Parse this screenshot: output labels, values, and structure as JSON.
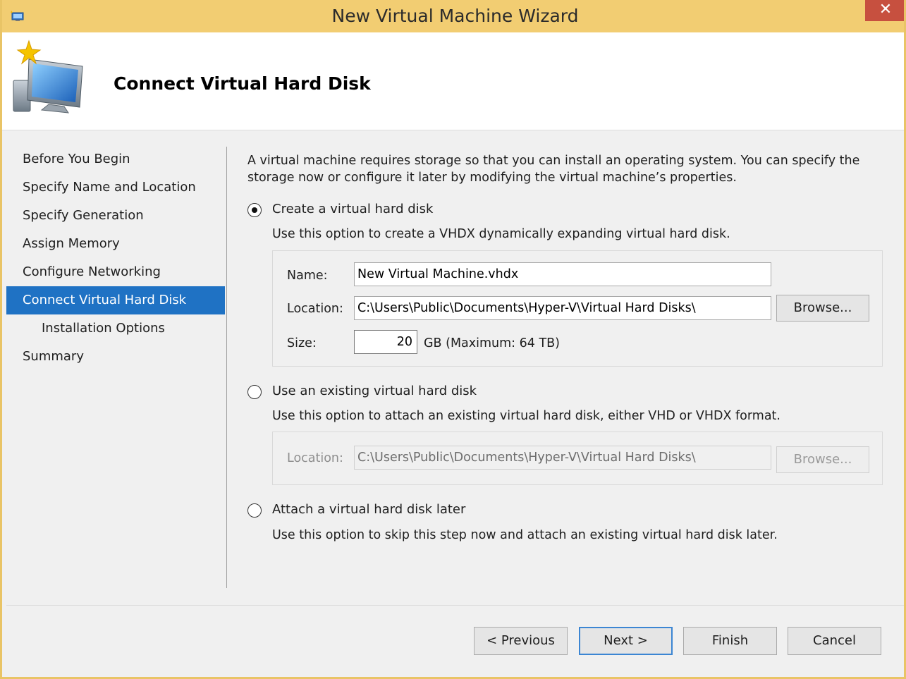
{
  "window": {
    "title": "New Virtual Machine Wizard",
    "close_glyph": "✕",
    "accent_color": "#f2cd72"
  },
  "header": {
    "title": "Connect Virtual Hard Disk",
    "icon": "virtual-machine-wizard-icon"
  },
  "nav": {
    "items": [
      {
        "label": "Before You Begin"
      },
      {
        "label": "Specify Name and Location"
      },
      {
        "label": "Specify Generation"
      },
      {
        "label": "Assign Memory"
      },
      {
        "label": "Configure Networking"
      },
      {
        "label": "Connect Virtual Hard Disk",
        "active": true
      },
      {
        "label": "Installation Options",
        "sub": true
      },
      {
        "label": "Summary"
      }
    ],
    "selected_color": "#1f72c4"
  },
  "content": {
    "intro_line1": "A virtual machine requires storage so that you can install an operating system. You can specify the",
    "intro_line2": "storage now or configure it later by modifying the virtual machine’s properties.",
    "create": {
      "label": "Create a virtual hard disk",
      "selected": true,
      "description": "Use this option to create a VHDX dynamically expanding virtual hard disk.",
      "name_label": "Name:",
      "name_value": "New Virtual Machine.vhdx",
      "location_label": "Location:",
      "location_value": "C:\\Users\\Public\\Documents\\Hyper-V\\Virtual Hard Disks\\",
      "browse_label": "Browse...",
      "size_label": "Size:",
      "size_value": "20",
      "size_suffix": "GB (Maximum: 64 TB)"
    },
    "existing": {
      "label": "Use an existing virtual hard disk",
      "selected": false,
      "description": "Use this option to attach an existing virtual hard disk, either VHD or VHDX format.",
      "location_label": "Location:",
      "location_value": "C:\\Users\\Public\\Documents\\Hyper-V\\Virtual Hard Disks\\",
      "browse_label": "Browse..."
    },
    "later": {
      "label": "Attach a virtual hard disk later",
      "selected": false,
      "description": "Use this option to skip this step now and attach an existing virtual hard disk later."
    }
  },
  "footer": {
    "previous_label": "< Previous",
    "next_label": "Next >",
    "finish_label": "Finish",
    "cancel_label": "Cancel"
  }
}
